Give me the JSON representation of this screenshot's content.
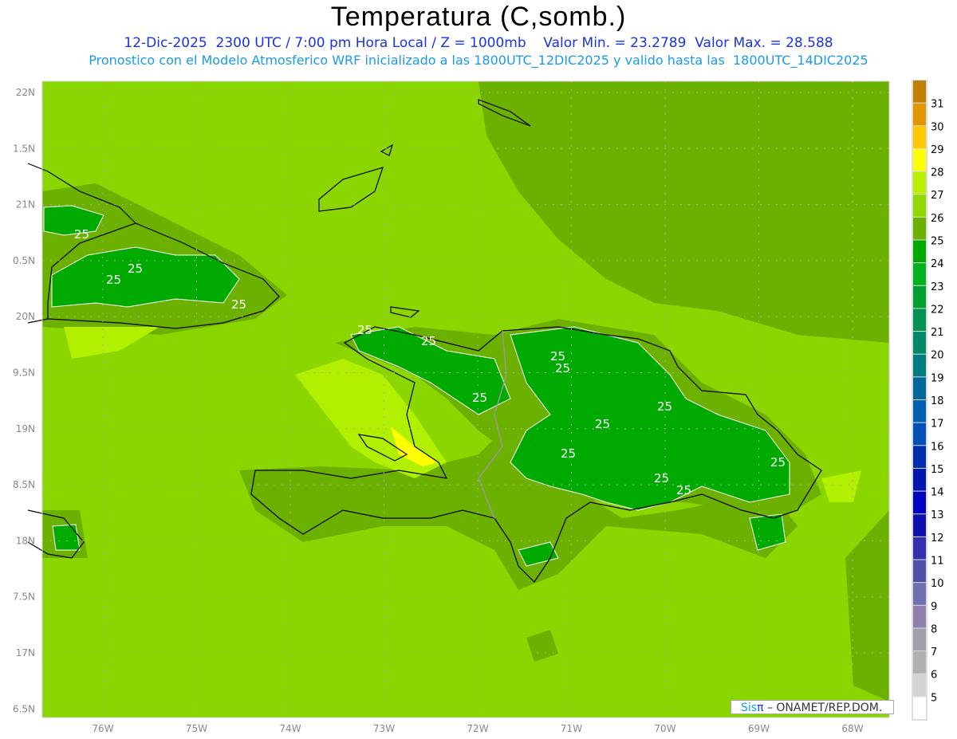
{
  "header": {
    "title": "Temperatura (C,somb.)",
    "subtitle1": "12-Dic-2025  2300 UTC / 7:00 pm Hora Local / Z = 1000mb    Valor Min. = 23.2789  Valor Max. = 28.588",
    "subtitle2": "Pronostico con el Modelo Atmosferico WRF inicializado a las 1800UTC_12DIC2025 y valido hasta las  1800UTC_14DIC2025"
  },
  "axes": {
    "lon_labels": [
      "76W",
      "75W",
      "74W",
      "73W",
      "72W",
      "71W",
      "70W",
      "69W",
      "68W"
    ],
    "lat_labels": [
      "22N",
      "1.5N",
      "21N",
      "0.5N",
      "20N",
      "9.5N",
      "19N",
      "8.5N",
      "18N",
      "7.5N",
      "17N",
      "6.5N"
    ]
  },
  "colorbar": {
    "labels": [
      "31",
      "30",
      "29",
      "28",
      "27",
      "26",
      "25",
      "24",
      "23",
      "22",
      "21",
      "20",
      "19",
      "18",
      "17",
      "16",
      "15",
      "14",
      "13",
      "12",
      "11",
      "10",
      "9",
      "8",
      "7",
      "6",
      "5"
    ],
    "colors": [
      "#c08000",
      "#e09800",
      "#ffc800",
      "#ffff00",
      "#b8f000",
      "#90d800",
      "#6cb000",
      "#00aa00",
      "#00b420",
      "#00a030",
      "#009450",
      "#008868",
      "#007c80",
      "#006898",
      "#0060b0",
      "#0050b8",
      "#0030b0",
      "#0018b0",
      "#0000c0",
      "#1010b0",
      "#3030b0",
      "#5050a8",
      "#7070b0",
      "#9080b0",
      "#a0a0a8",
      "#b0b0b0",
      "#d4d4d4",
      "#ffffff"
    ]
  },
  "contour_labels": [
    "25",
    "25",
    "25",
    "25",
    "25",
    "25",
    "25",
    "25",
    "25",
    "25",
    "25",
    "25",
    "25",
    "25",
    "25"
  ],
  "credit": {
    "brand": "Sis",
    "pi": "π",
    "rest": " – ONAMET/REP.DOM."
  }
}
